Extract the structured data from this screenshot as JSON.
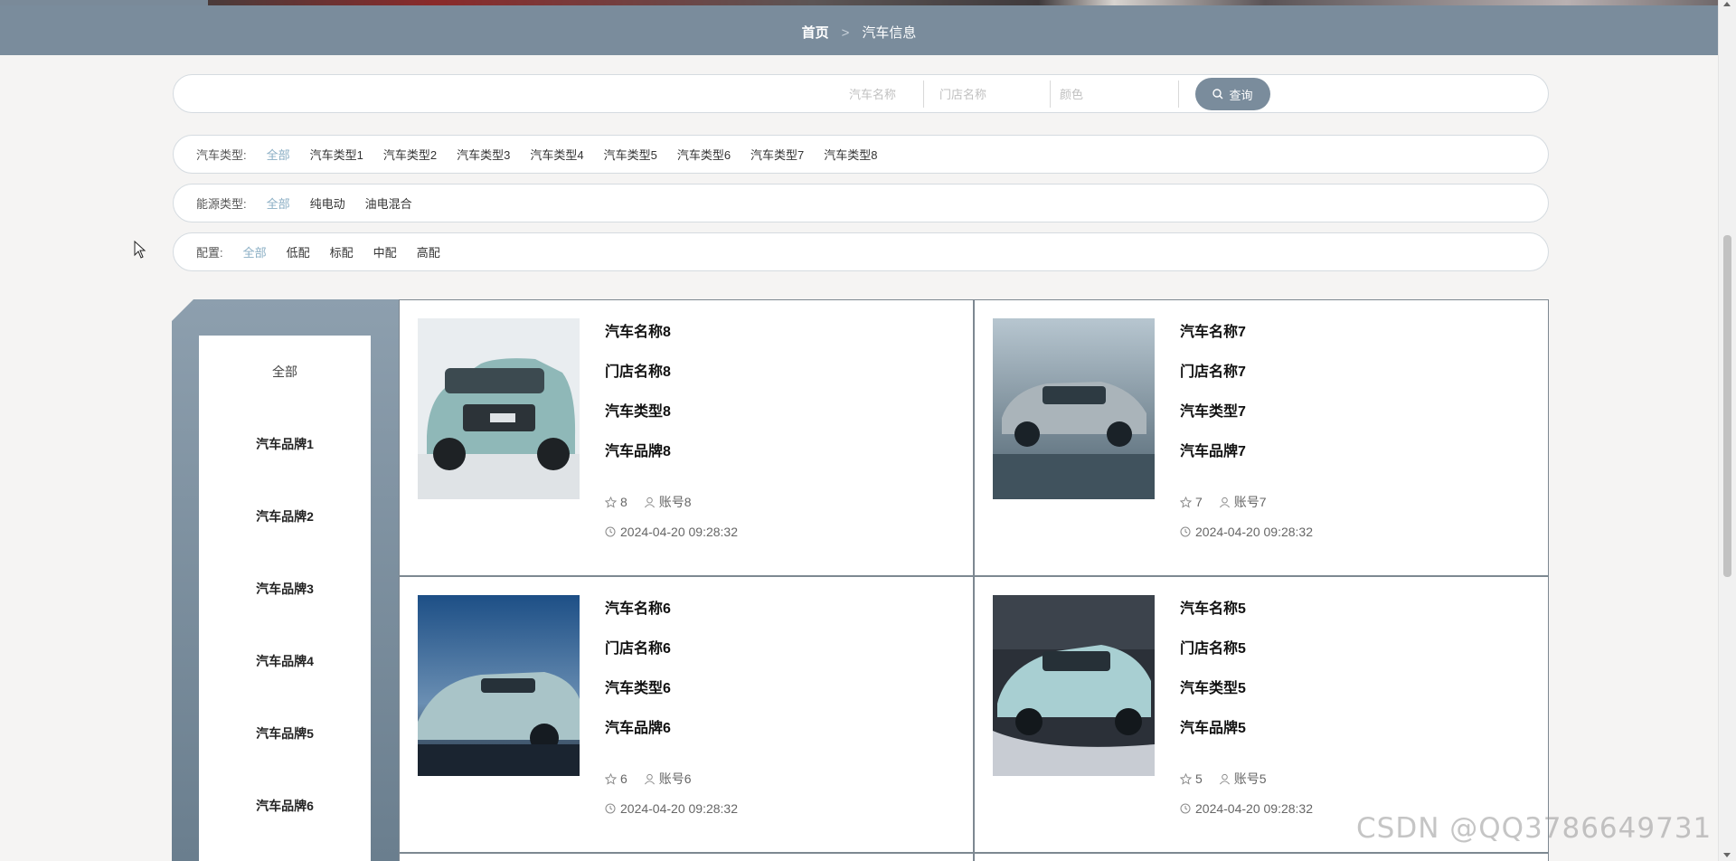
{
  "breadcrumb": {
    "home": "首页",
    "separator": ">",
    "current": "汽车信息"
  },
  "search": {
    "name_placeholder": "汽车名称",
    "store_placeholder": "门店名称",
    "color_placeholder": "颜色",
    "button_label": "查询",
    "button_icon": "search-icon"
  },
  "filters": {
    "car_type": {
      "label": "汽车类型:",
      "options": [
        "全部",
        "汽车类型1",
        "汽车类型2",
        "汽车类型3",
        "汽车类型4",
        "汽车类型5",
        "汽车类型6",
        "汽车类型7",
        "汽车类型8"
      ],
      "active": "全部"
    },
    "energy_type": {
      "label": "能源类型:",
      "options": [
        "全部",
        "纯电动",
        "油电混合"
      ],
      "active": "全部"
    },
    "config": {
      "label": "配置:",
      "options": [
        "全部",
        "低配",
        "标配",
        "中配",
        "高配"
      ],
      "active": "全部"
    }
  },
  "brands": [
    "全部",
    "汽车品牌1",
    "汽车品牌2",
    "汽车品牌3",
    "汽车品牌4",
    "汽车品牌5",
    "汽车品牌6"
  ],
  "cars": [
    {
      "name": "汽车名称8",
      "store": "门店名称8",
      "type": "汽车类型8",
      "brand": "汽车品牌8",
      "likes": "8",
      "account": "账号8",
      "date": "2024-04-20 09:28:32",
      "photo": "green SUV photo"
    },
    {
      "name": "汽车名称7",
      "store": "门店名称7",
      "type": "汽车类型7",
      "brand": "汽车品牌7",
      "likes": "7",
      "account": "账号7",
      "date": "2024-04-20 09:28:32",
      "photo": "silver crossover photo"
    },
    {
      "name": "汽车名称6",
      "store": "门店名称6",
      "type": "汽车类型6",
      "brand": "汽车品牌6",
      "likes": "6",
      "account": "账号6",
      "date": "2024-04-20 09:28:32",
      "photo": "teal sedan photo"
    },
    {
      "name": "汽车名称5",
      "store": "门店名称5",
      "type": "汽车类型5",
      "brand": "汽车品牌5",
      "likes": "5",
      "account": "账号5",
      "date": "2024-04-20 09:28:32",
      "photo": "mint hatchback photo"
    }
  ],
  "watermark": "CSDN @QQ3786649731",
  "colors": {
    "accent": "#7a8c9c",
    "active_filter": "#8aaec4",
    "card_border": "#7d8891"
  }
}
